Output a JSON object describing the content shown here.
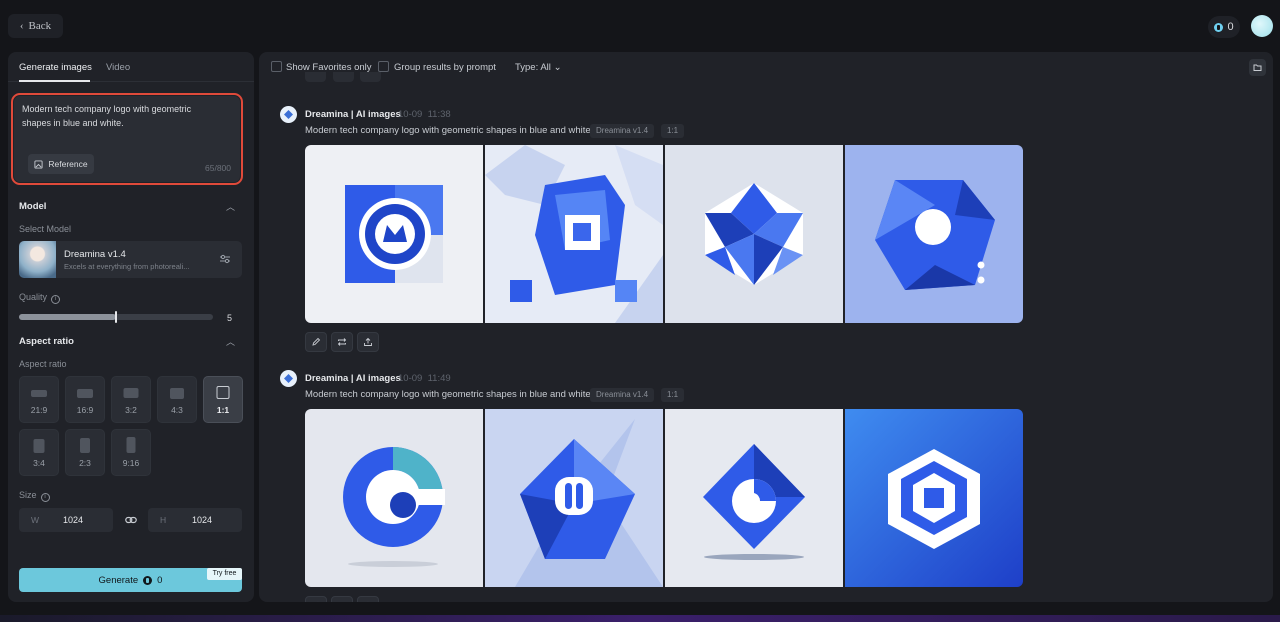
{
  "topbar": {
    "back_label": "Back",
    "credits": "0"
  },
  "left": {
    "tabs": [
      {
        "label": "Generate images",
        "active": true
      },
      {
        "label": "Video",
        "active": false
      }
    ],
    "prompt": {
      "value": "Modern tech company logo with geometric shapes in blue and white.",
      "char_count": "65/800",
      "reference_label": "Reference"
    },
    "model_section": {
      "title": "Model",
      "select_label": "Select Model",
      "model_name": "Dreamina v1.4",
      "model_desc": "Excels at everything from photoreali..."
    },
    "quality": {
      "label": "Quality",
      "value": "5",
      "fraction": 0.5
    },
    "aspect_section": {
      "title": "Aspect ratio",
      "sub_label": "Aspect ratio",
      "options": [
        "21:9",
        "16:9",
        "3:2",
        "4:3",
        "1:1",
        "3:4",
        "2:3",
        "9:16"
      ],
      "selected": "1:1"
    },
    "size": {
      "label": "Size",
      "w_prefix": "W",
      "w_value": "1024",
      "h_prefix": "H",
      "h_value": "1024"
    },
    "generate": {
      "label": "Generate",
      "cost": "0",
      "badge": "Try free"
    }
  },
  "filters": {
    "favorites_label": "Show Favorites only",
    "group_label": "Group results by prompt",
    "type_label": "Type: All"
  },
  "feed": [
    {
      "title": "Dreamina | AI images",
      "date": "10-09",
      "time": "11:38",
      "prompt": "Modern tech company logo with geometric shapes in blue and white.",
      "model_chip": "Dreamina v1.4",
      "ratio_chip": "1:1"
    },
    {
      "title": "Dreamina | AI images",
      "date": "10-09",
      "time": "11:49",
      "prompt": "Modern tech company logo with geometric shapes in blue and white.",
      "model_chip": "Dreamina v1.4",
      "ratio_chip": "1:1"
    }
  ],
  "colors": {
    "accent": "#6cc8dc",
    "highlight_border": "#e04a3a",
    "logo_blue": "#2f5be8"
  }
}
